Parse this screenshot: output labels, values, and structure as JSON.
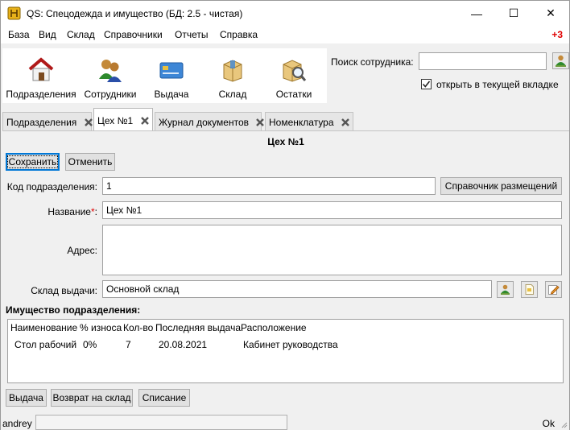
{
  "window": {
    "title": "QS: Спецодежда и имущество (БД: 2.5 - чистая)",
    "minimize_glyph": "—",
    "maximize_glyph": "☐",
    "close_glyph": "✕"
  },
  "menu": {
    "items": [
      "База",
      "Вид",
      "Склад",
      "Справочники",
      "Отчеты",
      "Справка"
    ],
    "badge": "+3",
    "badge_color": "#e00000"
  },
  "toolbar": {
    "buttons": [
      {
        "label": "Подразделения",
        "icon": "house-icon"
      },
      {
        "label": "Сотрудники",
        "icon": "people-icon"
      },
      {
        "label": "Выдача",
        "icon": "card-icon"
      },
      {
        "label": "Склад",
        "icon": "box-icon"
      },
      {
        "label": "Остатки",
        "icon": "box-search-icon"
      }
    ]
  },
  "search": {
    "label": "Поиск сотрудника:",
    "value": "",
    "open_in_current_tab_label": "открыть в текущей вкладке",
    "open_in_current_tab_checked": true
  },
  "tabs": [
    {
      "label": "Подразделения",
      "active": false
    },
    {
      "label": "Цех №1",
      "active": true
    },
    {
      "label": "Журнал документов",
      "active": false
    },
    {
      "label": "Номенклатура",
      "active": false
    }
  ],
  "form": {
    "title": "Цех №1",
    "save_label": "Сохранить",
    "cancel_label": "Отменить",
    "code_label": "Код подразделения:",
    "code_value": "1",
    "placement_ref_label": "Справочник размещений",
    "name_label": "Название",
    "name_required_mark": "*",
    "name_suffix": ":",
    "name_value": "Цех №1",
    "address_label": "Адрес:",
    "address_value": "",
    "warehouse_label": "Склад выдачи:",
    "warehouse_value": "Основной склад"
  },
  "property": {
    "section_title": "Имущество подразделения:",
    "columns": [
      "Наименование",
      "% износа",
      "Кол-во",
      "Последняя выдача",
      "Расположение"
    ],
    "rows": [
      [
        "Стол рабочий",
        "0%",
        "7",
        "20.08.2021",
        "Кабинет руководства"
      ]
    ],
    "issue_label": "Выдача",
    "return_label": "Возврат на склад",
    "writeoff_label": "Списание"
  },
  "status": {
    "user": "andrey",
    "state": "Ok"
  }
}
